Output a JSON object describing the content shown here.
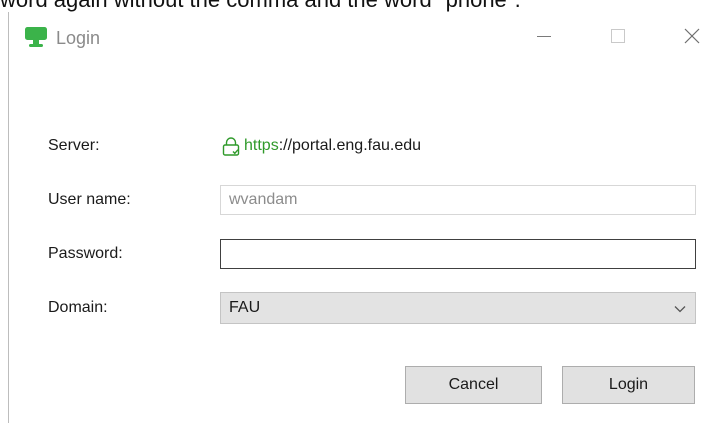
{
  "caption": "word again without the comma and the word \"phone\".",
  "window": {
    "title": "Login",
    "controls": {
      "minimize_icon": "minimize-icon",
      "maximize_icon": "maximize-icon",
      "close_icon": "close-icon"
    }
  },
  "form": {
    "server_label": "Server:",
    "server_scheme": "https",
    "server_rest": "://portal.eng.fau.edu",
    "username_label": "User name:",
    "username_value": "wvandam",
    "password_label": "Password:",
    "password_value": "",
    "domain_label": "Domain:",
    "domain_value": "FAU"
  },
  "buttons": {
    "cancel": "Cancel",
    "login": "Login"
  },
  "colors": {
    "secure_green": "#2f9a2a",
    "app_icon_green": "#3bb34a"
  }
}
